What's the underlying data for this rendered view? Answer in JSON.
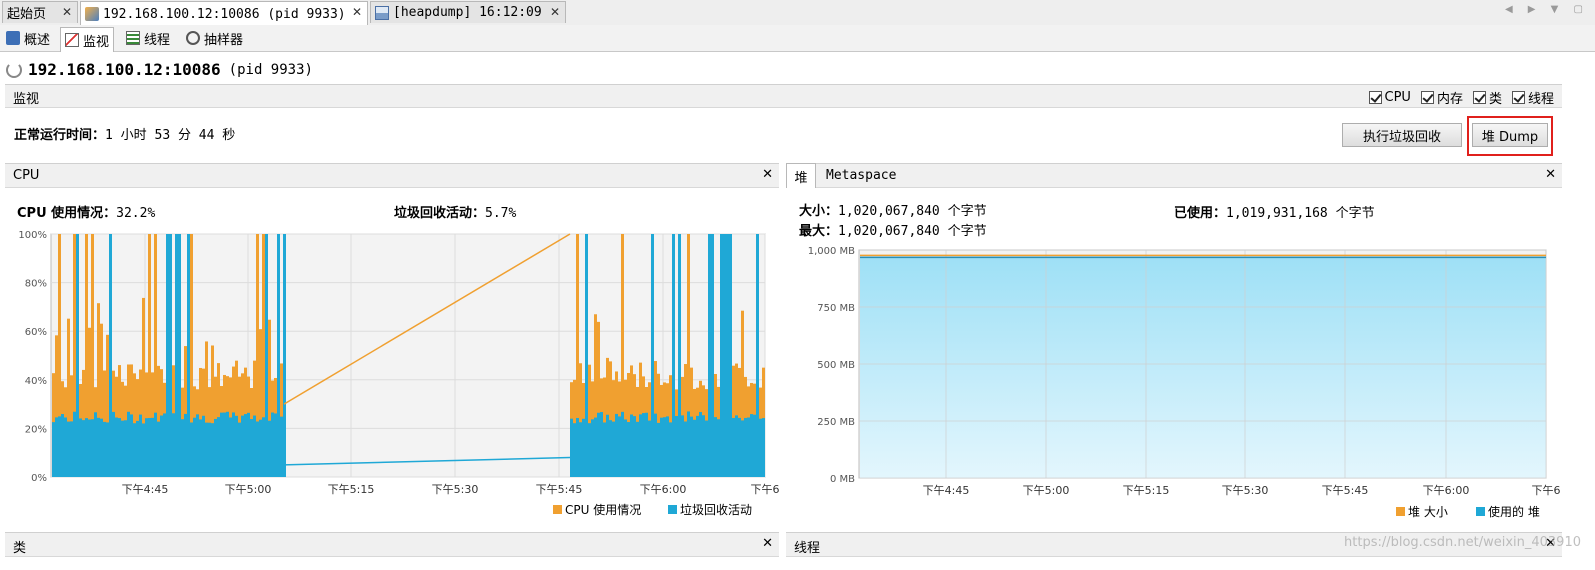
{
  "tabs": [
    {
      "label": "起始页",
      "active": false
    },
    {
      "label": "192.168.100.12:10086 (pid 9933)",
      "active": true
    },
    {
      "label": "[heapdump] 16:12:09",
      "active": false
    }
  ],
  "subtabs": [
    {
      "label": "概述"
    },
    {
      "label": "监视"
    },
    {
      "label": "线程"
    },
    {
      "label": "抽样器"
    }
  ],
  "app": {
    "title_host": "192.168.100.12:10086",
    "title_pid": "(pid 9933)"
  },
  "monitor": {
    "section_title": "监视",
    "checkboxes": [
      {
        "label": "CPU",
        "checked": true
      },
      {
        "label": "内存",
        "checked": true
      },
      {
        "label": "类",
        "checked": true
      },
      {
        "label": "线程",
        "checked": true
      }
    ],
    "uptime_label": "正常运行时间：",
    "uptime_value": "1 小时 53 分 44 秒",
    "gc_button": "执行垃圾回收",
    "dump_button": "堆 Dump"
  },
  "cpu_panel": {
    "title": "CPU",
    "usage_label": "CPU 使用情况：",
    "usage_value": "32.2%",
    "gc_label": "垃圾回收活动：",
    "gc_value": "5.7%"
  },
  "heap_panel": {
    "tab_heap": "堆",
    "tab_metaspace": "Metaspace",
    "size_label": "大小：",
    "size_value": "1,020,067,840 个字节",
    "max_label": "最大：",
    "max_value": "1,020,067,840 个字节",
    "used_label": "已使用：",
    "used_value": "1,019,931,168 个字节"
  },
  "bottom_panels": {
    "classes": "类",
    "threads": "线程"
  },
  "watermark": "https://blog.csdn.net/weixin_403910",
  "colors": {
    "cpu": "#f0a030",
    "gc": "#1fa8d6",
    "heap_size": "#f0a030",
    "heap_used": "#1fa8d6"
  },
  "chart_data": [
    {
      "type": "area",
      "title": "CPU",
      "x": [
        "下午4:45",
        "下午5:00",
        "下午5:15",
        "下午5:30",
        "下午5:45",
        "下午6:00",
        "下午6"
      ],
      "yticks": [
        "0%",
        "20%",
        "40%",
        "60%",
        "80%",
        "100%"
      ],
      "ylim": [
        0,
        100
      ],
      "grid": true,
      "legend_position": "bottom-right",
      "series": [
        {
          "name": "CPU 使用情况",
          "color": "#f0a030",
          "values_summary": {
            "active_band_typical": 40,
            "spikes_to": 100,
            "gap_line_from": 30,
            "gap_line_to": 100
          }
        },
        {
          "name": "垃圾回收活动",
          "color": "#1fa8d6",
          "values_summary": {
            "active_band_typical": 25,
            "spikes_to": 100,
            "gap_line_from": 5,
            "gap_line_to": 8
          }
        }
      ]
    },
    {
      "type": "area",
      "title": "堆",
      "x": [
        "下午4:45",
        "下午5:00",
        "下午5:15",
        "下午5:30",
        "下午5:45",
        "下午6:00",
        "下午6"
      ],
      "yticks": [
        "0 MB",
        "250 MB",
        "500 MB",
        "750 MB",
        "1,000 MB"
      ],
      "ylim": [
        0,
        1000
      ],
      "grid": true,
      "legend_position": "bottom-right",
      "series": [
        {
          "name": "堆 大小",
          "color": "#f0a030",
          "value": 972
        },
        {
          "name": "使用的 堆",
          "color": "#1fa8d6",
          "value": 972
        }
      ]
    }
  ]
}
